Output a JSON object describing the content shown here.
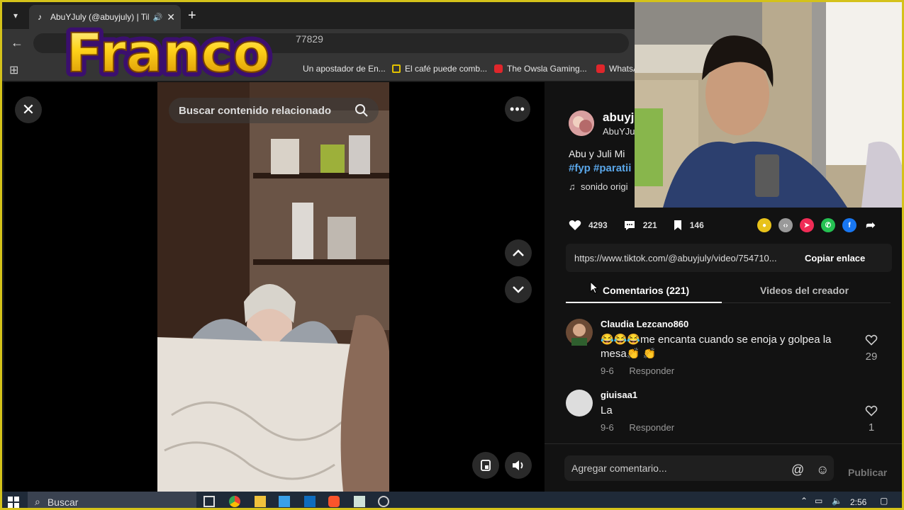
{
  "browser": {
    "tab_title": "AbuYJuly (@abuyjuly) | TikT",
    "url_tail": "77829",
    "bookmarks": [
      {
        "label": "Un apostador de En..."
      },
      {
        "label": "El café puede comb..."
      },
      {
        "label": "The Owsla Gaming..."
      },
      {
        "label": "WhatsA"
      }
    ]
  },
  "overlay": {
    "logo_text": "Franco"
  },
  "video": {
    "search_placeholder": "Buscar contenido relacionado"
  },
  "post": {
    "author_name": "abuyj",
    "author_id": "AbuYJu",
    "description": "Abu y Juli Mi",
    "hashtags": "#fyp #paratii",
    "sound": "sonido origi",
    "likes": "4293",
    "comments": "221",
    "saves": "146",
    "link": "https://www.tiktok.com/@abuyjuly/video/754710...",
    "copy_link_label": "Copiar enlace"
  },
  "tabs": {
    "comments_label": "Comentarios (221)",
    "creator_label": "Videos del creador"
  },
  "comments": [
    {
      "user": "Claudia Lezcano860",
      "text": "😂😂😂me encanta cuando se enoja y golpea la mesa👏 👏",
      "date": "9-6",
      "reply": "Responder",
      "likes": "29"
    },
    {
      "user": "giuisaa1",
      "text": "La",
      "date": "9-6",
      "reply": "Responder",
      "likes": "1"
    }
  ],
  "compose": {
    "placeholder": "Agregar comentario...",
    "publish_label": "Publicar"
  },
  "taskbar": {
    "search_label": "Buscar",
    "time": "2:56"
  }
}
